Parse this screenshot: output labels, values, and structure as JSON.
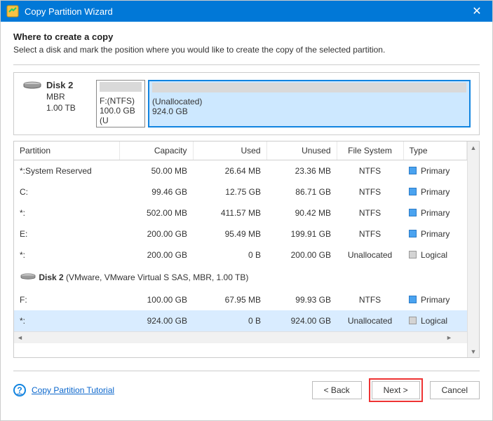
{
  "titlebar": {
    "title": "Copy Partition Wizard",
    "close_icon": "✕"
  },
  "page": {
    "heading": "Where to create a copy",
    "subheading": "Select a disk and mark the position where you would like to create the copy of the selected partition."
  },
  "disk_box": {
    "disk_name": "Disk 2",
    "disk_scheme": "MBR",
    "disk_size": "1.00 TB",
    "blocks": [
      {
        "title": "F:(NTFS)",
        "subtitle": "100.0 GB (U",
        "selected": false
      },
      {
        "title": "(Unallocated)",
        "subtitle": "924.0 GB",
        "selected": true
      }
    ]
  },
  "table": {
    "headers": {
      "partition": "Partition",
      "capacity": "Capacity",
      "used": "Used",
      "unused": "Unused",
      "fs": "File System",
      "type": "Type"
    },
    "rows": [
      {
        "partition": "*:System Reserved",
        "capacity": "50.00 MB",
        "used": "26.64 MB",
        "unused": "23.36 MB",
        "fs": "NTFS",
        "type": "Primary",
        "swatch": "blue"
      },
      {
        "partition": "C:",
        "capacity": "99.46 GB",
        "used": "12.75 GB",
        "unused": "86.71 GB",
        "fs": "NTFS",
        "type": "Primary",
        "swatch": "blue"
      },
      {
        "partition": "*:",
        "capacity": "502.00 MB",
        "used": "411.57 MB",
        "unused": "90.42 MB",
        "fs": "NTFS",
        "type": "Primary",
        "swatch": "blue"
      },
      {
        "partition": "E:",
        "capacity": "200.00 GB",
        "used": "95.49 MB",
        "unused": "199.91 GB",
        "fs": "NTFS",
        "type": "Primary",
        "swatch": "blue"
      },
      {
        "partition": "*:",
        "capacity": "200.00 GB",
        "used": "0 B",
        "unused": "200.00 GB",
        "fs": "Unallocated",
        "type": "Logical",
        "swatch": "gray"
      }
    ],
    "disk_row": {
      "name_bold": "Disk 2",
      "details": " (VMware, VMware Virtual S SAS, MBR, 1.00 TB)"
    },
    "rows2": [
      {
        "partition": "F:",
        "capacity": "100.00 GB",
        "used": "67.95 MB",
        "unused": "99.93 GB",
        "fs": "NTFS",
        "type": "Primary",
        "swatch": "blue",
        "selected": false
      },
      {
        "partition": "*:",
        "capacity": "924.00 GB",
        "used": "0 B",
        "unused": "924.00 GB",
        "fs": "Unallocated",
        "type": "Logical",
        "swatch": "gray",
        "selected": true
      }
    ]
  },
  "footer": {
    "tutorial_link": "Copy Partition Tutorial",
    "back": "< Back",
    "next": "Next >",
    "cancel": "Cancel"
  }
}
